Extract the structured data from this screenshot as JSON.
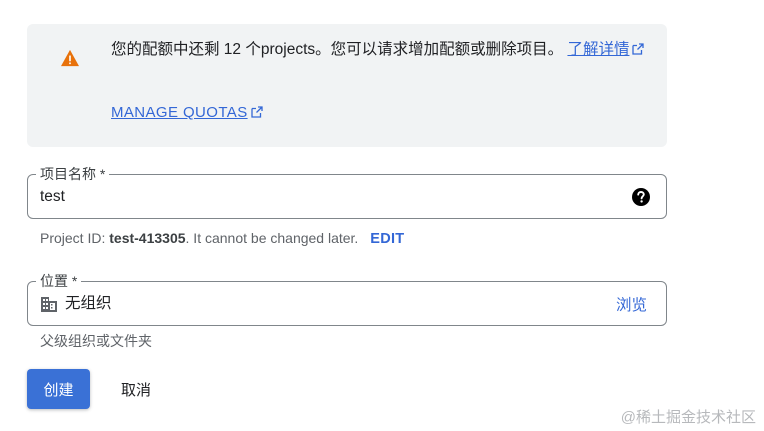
{
  "banner": {
    "message": "您的配额中还剩 12 个projects。您可以请求增加配额或删除项目。",
    "learn_more_label": "了解详情",
    "manage_quotas_label": "MANAGE QUOTAS",
    "icon": "warning-icon",
    "icon_color": "#e8710a"
  },
  "project_name": {
    "label": "项目名称 *",
    "value": "test",
    "help_icon": "help-icon"
  },
  "project_id": {
    "prefix": "Project ID: ",
    "id": "test-413305",
    "suffix": ". It cannot be changed later.",
    "edit_label": "EDIT"
  },
  "location": {
    "label": "位置 *",
    "value": "无组织",
    "icon": "building-icon",
    "browse_label": "浏览",
    "helper": "父级组织或文件夹"
  },
  "actions": {
    "create_label": "创建",
    "cancel_label": "取消"
  },
  "watermark": "@稀土掘金技术社区",
  "colors": {
    "accent": "#3367d6",
    "primary_button": "#3a71d6",
    "banner_bg": "#f1f3f4",
    "warning": "#e8710a"
  }
}
